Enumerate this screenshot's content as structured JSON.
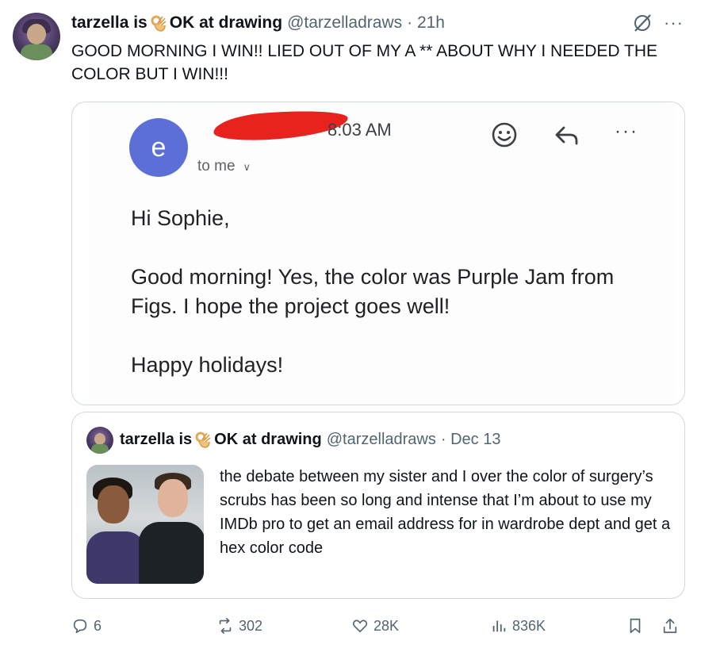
{
  "tweet": {
    "author_name": "tarzella is",
    "author_name_suffix": "OK at drawing",
    "handle": "@tarzelladraws",
    "time": "· 21h",
    "text": "GOOD MORNING I WIN!! LIED OUT OF MY A ** ABOUT WHY I NEEDED THE COLOR BUT I WIN!!!"
  },
  "email": {
    "sender_initial": "e",
    "time": "8:03 AM",
    "recipient": "to me",
    "greeting": "Hi Sophie,",
    "body": "Good morning! Yes, the color was Purple Jam from Figs. I hope the project goes well!",
    "signoff": "Happy holidays!"
  },
  "quote": {
    "author_name": "tarzella is",
    "author_name_suffix": "OK at drawing",
    "handle": "@tarzelladraws",
    "time": "· Dec 13",
    "text": "the debate between my sister and I over the color of surgery’s scrubs has been so long and intense that I’m about to use my IMDb pro to get an email address for in wardrobe dept and get a hex color code"
  },
  "actions": {
    "replies": "6",
    "reposts": "302",
    "likes": "28K",
    "views": "836K"
  },
  "icons": {
    "grok": "grok-icon",
    "more": "more-icon",
    "emoji": "emoji-icon",
    "reply": "reply-arrow-icon",
    "ok_hand": "ok-hand-emoji-icon"
  },
  "colors": {
    "email_avatar": "#5b6fd6",
    "redaction": "#e8231d",
    "secondary_text": "#536471"
  }
}
